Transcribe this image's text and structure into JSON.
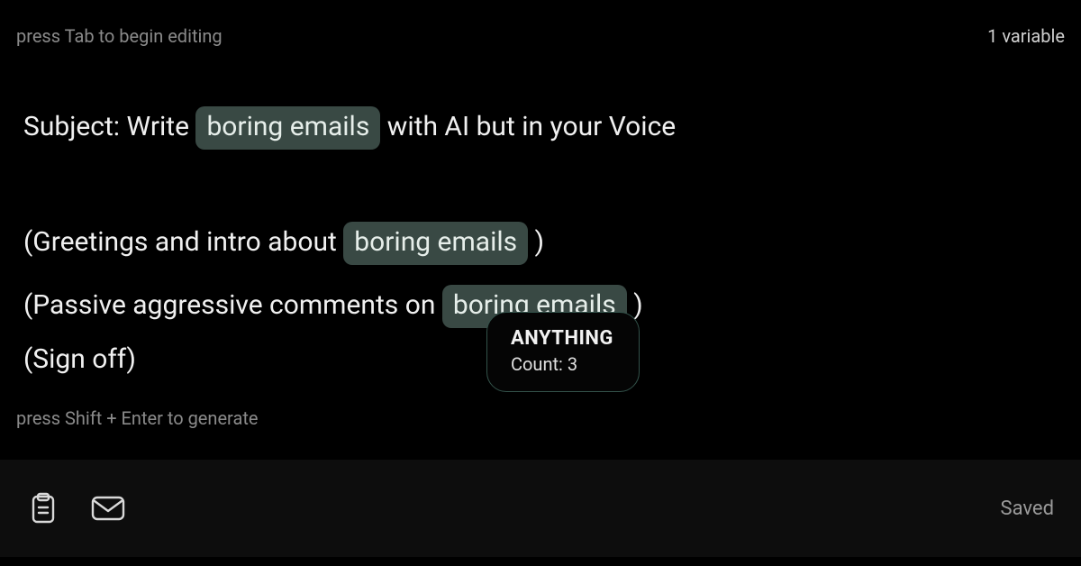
{
  "hints": {
    "top": "press Tab to begin editing",
    "bottom": "press Shift + Enter to generate"
  },
  "variable_count_label": "1 variable",
  "content": {
    "subject_prefix": "Subject: Write",
    "subject_suffix": "with AI but in your Voice",
    "line2_prefix": "(Greetings and intro about",
    "line2_suffix": ")",
    "line3_prefix": "(Passive aggressive comments on",
    "line3_suffix": ")",
    "line4": "(Sign off)",
    "variable_chip": "boring emails"
  },
  "tooltip": {
    "title": "ANYTHING",
    "count_label": "Count: 3"
  },
  "toolbar": {
    "saved_label": "Saved"
  }
}
